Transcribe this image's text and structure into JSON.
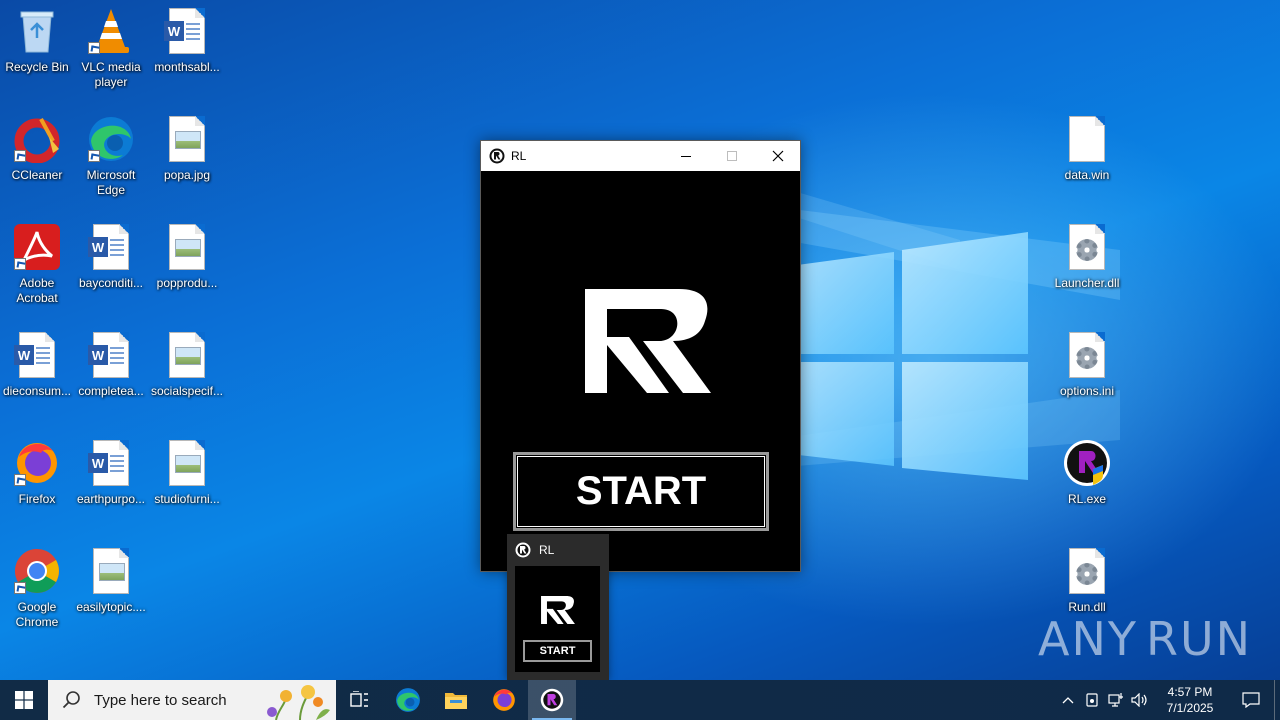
{
  "desktop": {
    "icons": [
      {
        "id": "recycle-bin",
        "label": "Recycle Bin"
      },
      {
        "id": "vlc",
        "label": "VLC media player"
      },
      {
        "id": "monthsable",
        "label": "monthsabl..."
      },
      {
        "id": "ccleaner",
        "label": "CCleaner"
      },
      {
        "id": "edge",
        "label": "Microsoft Edge"
      },
      {
        "id": "popa",
        "label": "popa.jpg"
      },
      {
        "id": "acrobat",
        "label": "Adobe Acrobat"
      },
      {
        "id": "bayconditi",
        "label": "bayconditi..."
      },
      {
        "id": "popprodu",
        "label": "popprodu..."
      },
      {
        "id": "dieconsum",
        "label": "dieconsum..."
      },
      {
        "id": "completea",
        "label": "completea..."
      },
      {
        "id": "socialspecif",
        "label": "socialspecif..."
      },
      {
        "id": "firefox",
        "label": "Firefox"
      },
      {
        "id": "earthpurpo",
        "label": "earthpurpo..."
      },
      {
        "id": "studiofurni",
        "label": "studiofurni..."
      },
      {
        "id": "chrome",
        "label": "Google Chrome"
      },
      {
        "id": "easilytopic",
        "label": "easilytopic...."
      },
      {
        "id": "data-win",
        "label": "data.win"
      },
      {
        "id": "launcher-dll",
        "label": "Launcher.dll"
      },
      {
        "id": "options-ini",
        "label": "options.ini"
      },
      {
        "id": "rl-exe",
        "label": "RL.exe"
      },
      {
        "id": "run-dll",
        "label": "Run.dll"
      }
    ]
  },
  "window": {
    "title": "RL",
    "start_label": "START"
  },
  "thumbnail": {
    "title": "RL",
    "start_label": "START"
  },
  "watermark": {
    "left": "ANY",
    "right": "RUN"
  },
  "taskbar": {
    "search_placeholder": "Type here to search",
    "time": "4:57 PM",
    "date": "7/1/2025"
  },
  "colors": {
    "desktop_blue": "#0a78dc",
    "taskbar": "#102b47",
    "window_bg": "#000000",
    "button_border": "#9a9a9a"
  }
}
